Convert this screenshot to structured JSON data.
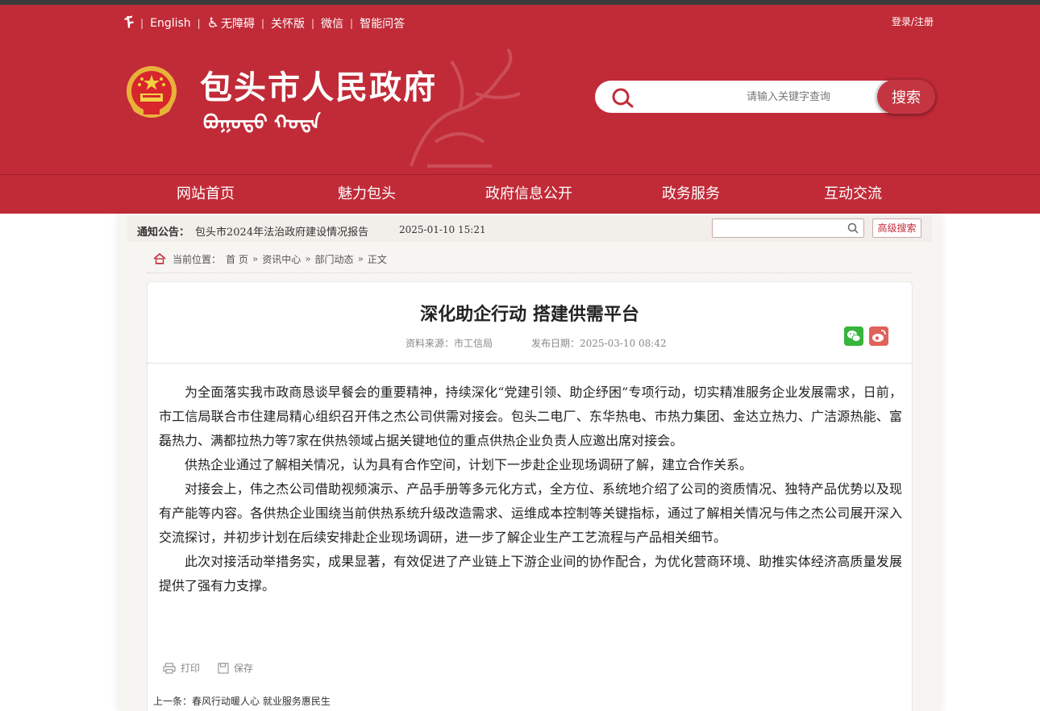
{
  "colors": {
    "brand_red": "#c12b38",
    "panel_bg": "#f7f5f2"
  },
  "topbar": {
    "mongol_icon": "ᠮ",
    "english": "English",
    "accessibility": "无障碍",
    "elder_mode": "关怀版",
    "wechat": "微信",
    "qa": "智能问答",
    "login": "登录/注册"
  },
  "site": {
    "title": "包头市人民政府",
    "mongol_title": "ᠪᠤᠭᠤᠲᠤ ᠬᠣᠲᠠ"
  },
  "search": {
    "placeholder": "请输入关键字查询",
    "button": "搜索"
  },
  "nav": {
    "items": [
      {
        "label": "网站首页"
      },
      {
        "label": "魅力包头"
      },
      {
        "label": "政府信息公开"
      },
      {
        "label": "政务服务"
      },
      {
        "label": "互动交流"
      }
    ]
  },
  "notice": {
    "label": "通知公告：",
    "text": "包头市2024年法治政府建设情况报告",
    "date": "2025-01-10 15:21",
    "advanced_search": "高级搜索"
  },
  "breadcrumb": {
    "prefix": "当前位置：",
    "items": [
      "首 页",
      "资讯中心",
      "部门动态",
      "正文"
    ]
  },
  "article": {
    "title": "深化助企行动  搭建供需平台",
    "source": "资料来源：市工信局",
    "date": "发布日期：2025-03-10 08:42",
    "paragraphs": [
      "为全面落实我市政商恳谈早餐会的重要精神，持续深化“党建引领、助企纾困”专项行动，切实精准服务企业发展需求，日前，市工信局联合市住建局精心组织召开伟之杰公司供需对接会。包头二电厂、东华热电、市热力集团、金达立热力、广洁源热能、富磊热力、满都拉热力等7家在供热领域占据关键地位的重点供热企业负责人应邀出席对接会。",
      "供热企业通过了解相关情况，认为具有合作空间，计划下一步赴企业现场调研了解，建立合作关系。",
      "对接会上，伟之杰公司借助视频演示、产品手册等多元化方式，全方位、系统地介绍了公司的资质情况、独特产品优势以及现有产能等内容。各供热企业围绕当前供热系统升级改造需求、运维成本控制等关键指标，通过了解相关情况与伟之杰公司展开深入交流探讨，并初步计划在后续安排赴企业现场调研，进一步了解企业生产工艺流程与产品相关细节。",
      "此次对接活动举措务实，成果显著，有效促进了产业链上下游企业间的协作配合，为优化营商环境、助推实体经济高质量发展提供了强有力支撑。"
    ]
  },
  "tools": {
    "print": "打印",
    "save": "保存"
  },
  "prev": {
    "label": "上一条：",
    "title": "春风行动暖人心 就业服务惠民生"
  }
}
